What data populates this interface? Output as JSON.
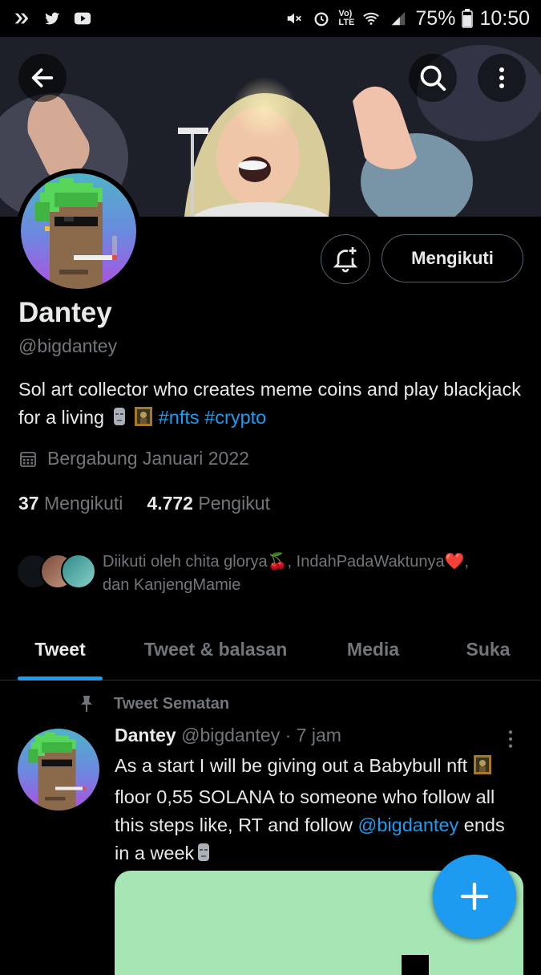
{
  "status_bar": {
    "battery": "75%",
    "time": "10:50",
    "network": "LTE"
  },
  "profile": {
    "name": "Dantey",
    "handle": "@bigdantey",
    "bio_text": "Sol art collector who creates meme coins and play blackjack for a living",
    "bio_hashtags": [
      "#nfts",
      "#crypto"
    ],
    "joined": "Bergabung Januari 2022",
    "following_count": "37",
    "following_label": "Mengikuti",
    "followers_count": "4.772",
    "followers_label": "Pengikut",
    "follow_button_label": "Mengikuti",
    "followed_by_line1": "Diikuti oleh chita glorya🍒, IndahPadaWaktunya❤️,",
    "followed_by_line2": "dan KanjengMamie"
  },
  "tabs": [
    {
      "label": "Tweet",
      "active": true
    },
    {
      "label": "Tweet & balasan",
      "active": false
    },
    {
      "label": "Media",
      "active": false
    },
    {
      "label": "Suka",
      "active": false
    }
  ],
  "pinned_tweet": {
    "pinned_label": "Tweet Sematan",
    "author_name": "Dantey",
    "author_handle": "@bigdantey",
    "separator": "·",
    "time": "7 jam",
    "text_part1": "As a start I will be giving out a Babybull nft",
    "text_part2": "floor 0,55 SOLANA to someone who follow all this steps like, RT and follow",
    "mention": "@bigdantey",
    "text_part3": "ends in a week"
  },
  "colors": {
    "accent": "#1d9bf0",
    "background": "#000000",
    "muted": "#71767b",
    "text": "#e7e9ea"
  },
  "icons": [
    "back-arrow-icon",
    "search-icon",
    "more-vertical-icon",
    "bell-plus-icon",
    "calendar-icon",
    "pin-icon",
    "compose-plus-icon"
  ]
}
